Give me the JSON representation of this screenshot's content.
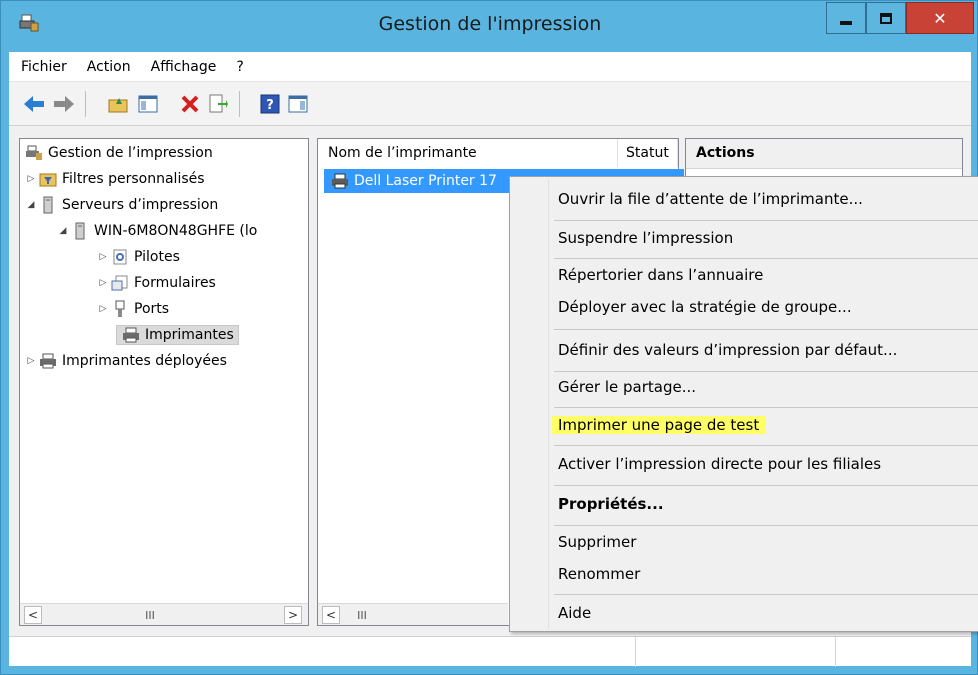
{
  "window": {
    "title": "Gestion de l'impression"
  },
  "menubar": {
    "items": [
      "Fichier",
      "Action",
      "Affichage",
      "?"
    ]
  },
  "tree": {
    "root": "Gestion de l’impression",
    "items": [
      {
        "label": "Filtres personnalisés"
      },
      {
        "label": "Serveurs d’impression"
      },
      {
        "label": "WIN-6M8ON48GHFE (lo"
      },
      {
        "label": "Pilotes"
      },
      {
        "label": "Formulaires"
      },
      {
        "label": "Ports"
      },
      {
        "label": "Imprimantes"
      },
      {
        "label": "Imprimantes déployées"
      }
    ]
  },
  "list": {
    "columns": [
      "Nom de l’imprimante",
      "Statut"
    ],
    "row": {
      "name": "Dell Laser Printer 17"
    }
  },
  "actions": {
    "header": "Actions"
  },
  "context_menu": {
    "items": [
      "Ouvrir la file d’attente de l’imprimante...",
      "Suspendre l’impression",
      "Répertorier dans l’annuaire",
      "Déployer avec la stratégie de groupe...",
      "Définir des valeurs d’impression par défaut...",
      "Gérer le partage...",
      "Imprimer une page de test",
      "Activer l’impression directe pour les filiales",
      "Propriétés...",
      "Supprimer",
      "Renommer",
      "Aide"
    ]
  },
  "scroll": {
    "thumb": "III",
    "left": "<",
    "right": ">"
  },
  "colors": {
    "title_bar": "#59b4df",
    "selection": "#3399ff",
    "highlight": "#ffff66",
    "close": "#c84236"
  }
}
